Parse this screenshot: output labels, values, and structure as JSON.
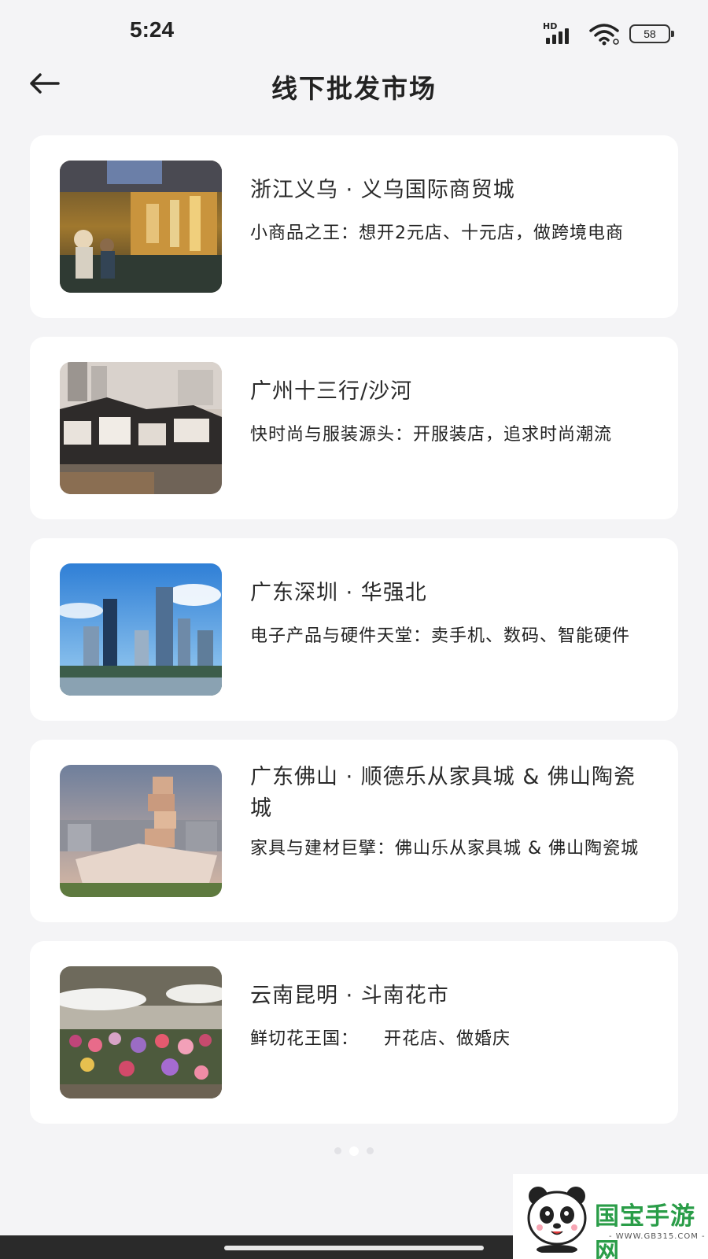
{
  "status_bar": {
    "time": "5:24",
    "signal_label": "HD",
    "battery_level": "58"
  },
  "header": {
    "title": "线下批发市场",
    "back_icon": "arrow-left-icon"
  },
  "markets": [
    {
      "name": "浙江义乌 · 义乌国际商贸城",
      "description": "小商品之王：想开2元店、十元店，做跨境电商"
    },
    {
      "name": "广州十三行/沙河",
      "description": "快时尚与服装源头：开服装店，追求时尚潮流"
    },
    {
      "name": "广东深圳 · 华强北",
      "description": "电子产品与硬件天堂：卖手机、数码、智能硬件"
    },
    {
      "name": "广东佛山 · 顺德乐从家具城 & 佛山陶瓷城",
      "description": "家具与建材巨擘：佛山乐从家具城 & 佛山陶瓷城"
    },
    {
      "name": "云南昆明 · 斗南花市",
      "description": "鲜切花王国：    开花店、做婚庆"
    }
  ],
  "pagination": {
    "count": 3,
    "active_index": 1
  },
  "watermark": {
    "brand": "国宝手游网",
    "url": "- WWW.GB315.COM -"
  },
  "colors": {
    "background": "#f4f4f6",
    "card": "#ffffff",
    "watermark_green": "#2a9d48"
  }
}
